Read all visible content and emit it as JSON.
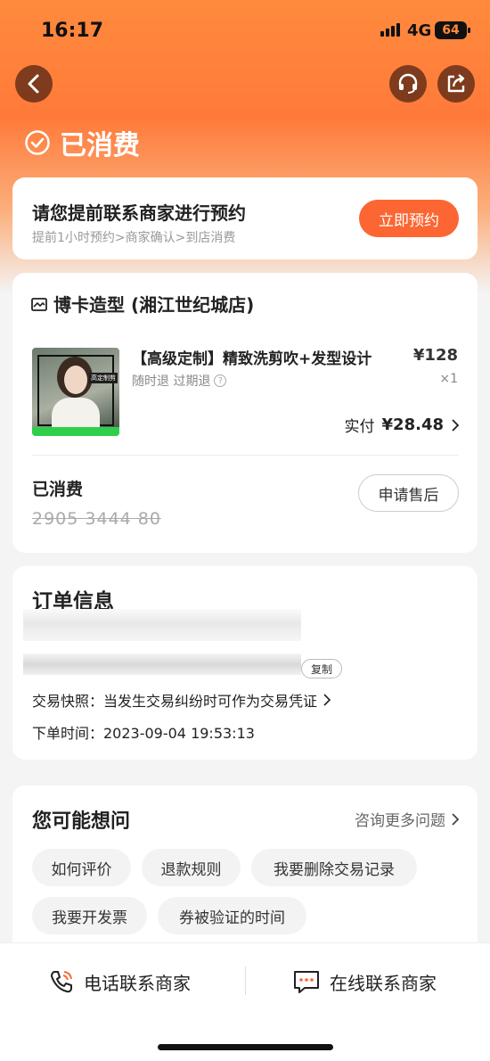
{
  "status_bar": {
    "time": "16:17",
    "network": "4G",
    "battery": "64"
  },
  "header": {
    "status_title": "已消费"
  },
  "booking": {
    "title": "请您提前联系商家进行预约",
    "subtitle": "提前1小时预约>商家确认>到店消费",
    "button": "立即预约"
  },
  "order": {
    "shop_name": "博卡造型 (湘江世纪城店)",
    "product_name": "【高级定制】精致洗剪吹+发型设计",
    "tags": "随时退 过期退",
    "price": "¥128",
    "qty": "×1",
    "paid_label": "实付",
    "paid_amount": "¥28.48",
    "consumed_label": "已消费",
    "code": "2905 3444 80",
    "after_sale_button": "申请售后",
    "image_tag": "高定制剪"
  },
  "order_info": {
    "title": "订单信息",
    "copy_button": "复制",
    "snapshot": "交易快照：当发生交易纠纷时可作为交易凭证",
    "order_time": "下单时间：2023-09-04 19:53:13"
  },
  "faq": {
    "title": "您可能想问",
    "more": "咨询更多问题",
    "chips": [
      "如何评价",
      "退款规则",
      "我要删除交易记录",
      "我要开发票",
      "券被验证的时间"
    ]
  },
  "bottom_bar": {
    "phone": "电话联系商家",
    "online": "在线联系商家"
  },
  "colors": {
    "accent": "#fb6633",
    "hero": "#ff8a3d"
  }
}
